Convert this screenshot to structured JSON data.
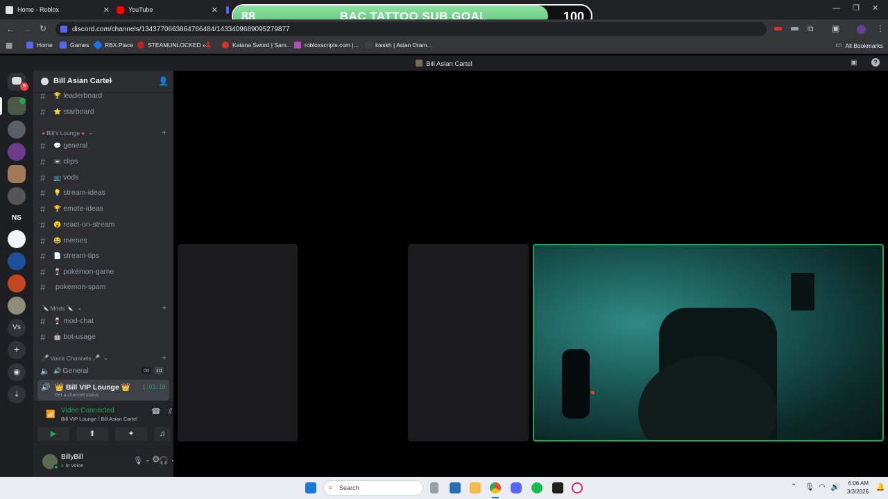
{
  "browser": {
    "tabs": [
      {
        "title": "Home - Roblox"
      },
      {
        "title": "YouTube"
      }
    ],
    "url": "discord.com/channels/1343770663864766484/1433409689095279877",
    "bookmarks": [
      {
        "label": "Home"
      },
      {
        "label": "Games"
      },
      {
        "label": "RBX.Place"
      },
      {
        "label": "STEAMUNLOCKED »..."
      },
      {
        "label": "Katana Sword | Sam..."
      },
      {
        "label": "robloxscripts.com |..."
      },
      {
        "label": "kisskh | Asian Dram..."
      }
    ],
    "all_bookmarks": "All Bookmarks"
  },
  "overlay": {
    "start": "88",
    "title": "BAC TATTOO SUB GOAL",
    "goal": "100",
    "progress_fraction": 0.88
  },
  "window_title": "Bill Asian Cartel",
  "server": {
    "name": "Bill Asian Cartel",
    "dm_badge": "5",
    "rail_label_ns": "NS",
    "rail_label_vs": "Vs"
  },
  "channels_top": [
    {
      "name": "leaderboard",
      "emoji": "🏆"
    },
    {
      "name": "starboard",
      "emoji": "⭐"
    }
  ],
  "lounge": {
    "category": "Bill's Lounge",
    "channels": [
      {
        "name": "general",
        "emoji": "💬"
      },
      {
        "name": "clips",
        "emoji": "📼"
      },
      {
        "name": "vods",
        "emoji": "📺"
      },
      {
        "name": "stream-ideas",
        "emoji": "💡"
      },
      {
        "name": "emote-ideas",
        "emoji": "🏆"
      },
      {
        "name": "react-on-stream",
        "emoji": "😮"
      },
      {
        "name": "memes",
        "emoji": "😂"
      },
      {
        "name": "stream-tips",
        "emoji": "📄"
      },
      {
        "name": "pokémon-game",
        "emoji": "🍷"
      },
      {
        "name": "pokemon-spam",
        "emoji": ""
      }
    ]
  },
  "mods": {
    "category": "Mods",
    "channels": [
      {
        "name": "mod-chat",
        "emoji": "🍷"
      },
      {
        "name": "bot-usage",
        "emoji": "🤖"
      }
    ]
  },
  "voice": {
    "category": "Voice Channels",
    "channels": [
      {
        "name": "General",
        "emoji": "🔊",
        "count_a": "00",
        "count_b": "10"
      },
      {
        "name": "Bill VIP Lounge",
        "emoji": "👑",
        "timer": "1:01:16",
        "status": "Set a channel status"
      }
    ]
  },
  "connection": {
    "status": "Video Connected",
    "location": "Bill VIP Lounge / Bill Asian Cartel"
  },
  "user": {
    "name": "BillyBill",
    "status": "In voice"
  },
  "taskbar": {
    "search_placeholder": "Search",
    "time": "6:06 AM",
    "date": "3/3/2026"
  }
}
